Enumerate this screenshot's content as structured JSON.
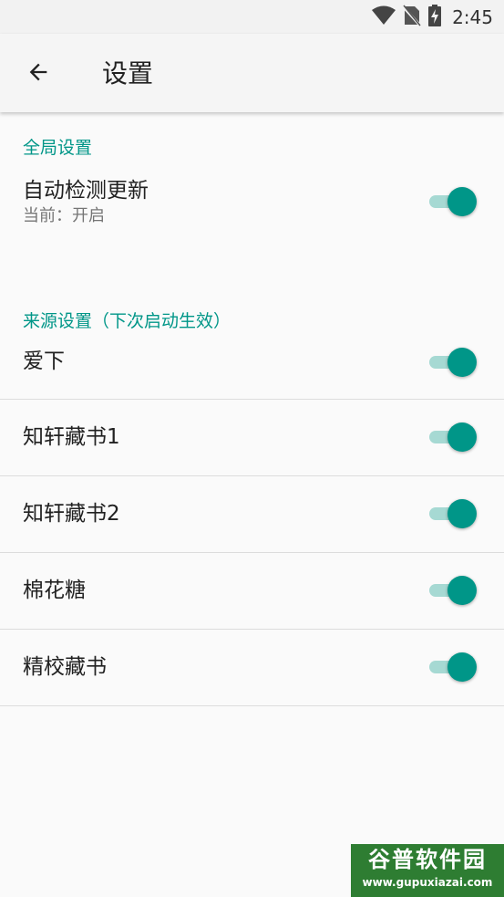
{
  "status_bar": {
    "time": "2:45",
    "icons": [
      "wifi-icon",
      "no-sim-icon",
      "battery-charging-icon"
    ]
  },
  "app_bar": {
    "back_icon": "arrow-back-icon",
    "title": "设置"
  },
  "sections": {
    "global": {
      "header": "全局设置",
      "auto_update": {
        "title": "自动检测更新",
        "summary": "当前：开启",
        "enabled": true
      }
    },
    "sources": {
      "header": "来源设置（下次启动生效）",
      "items": [
        {
          "title": "爱下",
          "enabled": true
        },
        {
          "title": "知轩藏书1",
          "enabled": true
        },
        {
          "title": "知轩藏书2",
          "enabled": true
        },
        {
          "title": "棉花糖",
          "enabled": true
        },
        {
          "title": "精校藏书",
          "enabled": true
        }
      ]
    }
  },
  "colors": {
    "accent": "#009688",
    "switch_track_on": "#a6d9d3",
    "background": "#fafafa",
    "app_bar": "#f5f5f5"
  },
  "watermark": {
    "logo": "谷普软件园",
    "url": "www.gupuxiazai.com"
  }
}
